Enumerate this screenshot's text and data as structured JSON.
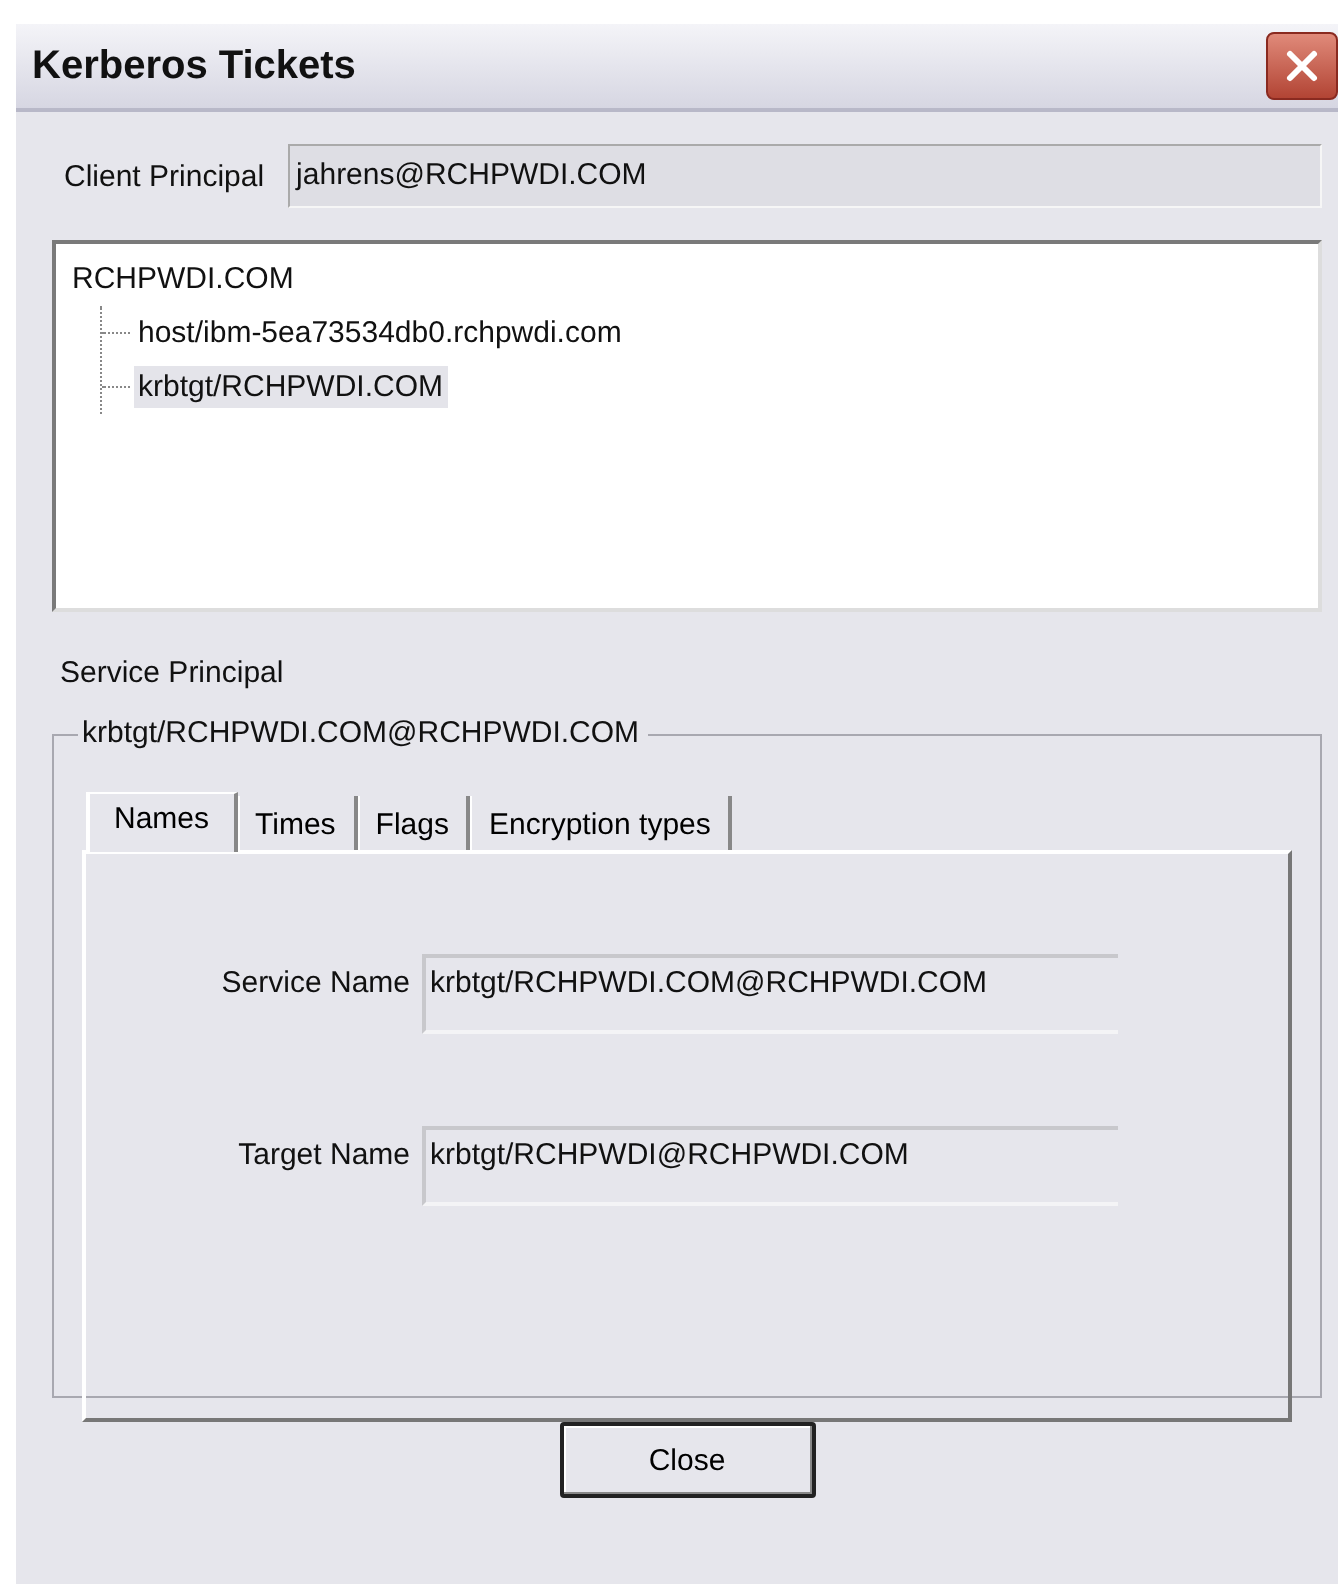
{
  "window": {
    "title": "Kerberos Tickets"
  },
  "client_principal": {
    "label": "Client Principal",
    "value": "jahrens@RCHPWDI.COM"
  },
  "tree": [
    {
      "label": "RCHPWDI.COM",
      "selected": false,
      "children": [
        {
          "label": "host/ibm-5ea73534db0.rchpwdi.com",
          "selected": false
        },
        {
          "label": "krbtgt/RCHPWDI.COM",
          "selected": true
        }
      ]
    }
  ],
  "service_principal": {
    "label": "Service Principal",
    "group_title": "krbtgt/RCHPWDI.COM@RCHPWDI.COM"
  },
  "tabs": [
    {
      "label": "Names",
      "selected": true
    },
    {
      "label": "Times",
      "selected": false
    },
    {
      "label": "Flags",
      "selected": false
    },
    {
      "label": "Encryption types",
      "selected": false
    }
  ],
  "fields": [
    {
      "label": "Service Name",
      "value": "krbtgt/RCHPWDI.COM@RCHPWDI.COM"
    },
    {
      "label": "Target Name",
      "value": "krbtgt/RCHPWDI@RCHPWDI.COM"
    }
  ],
  "buttons": [
    {
      "label": "Close"
    }
  ]
}
